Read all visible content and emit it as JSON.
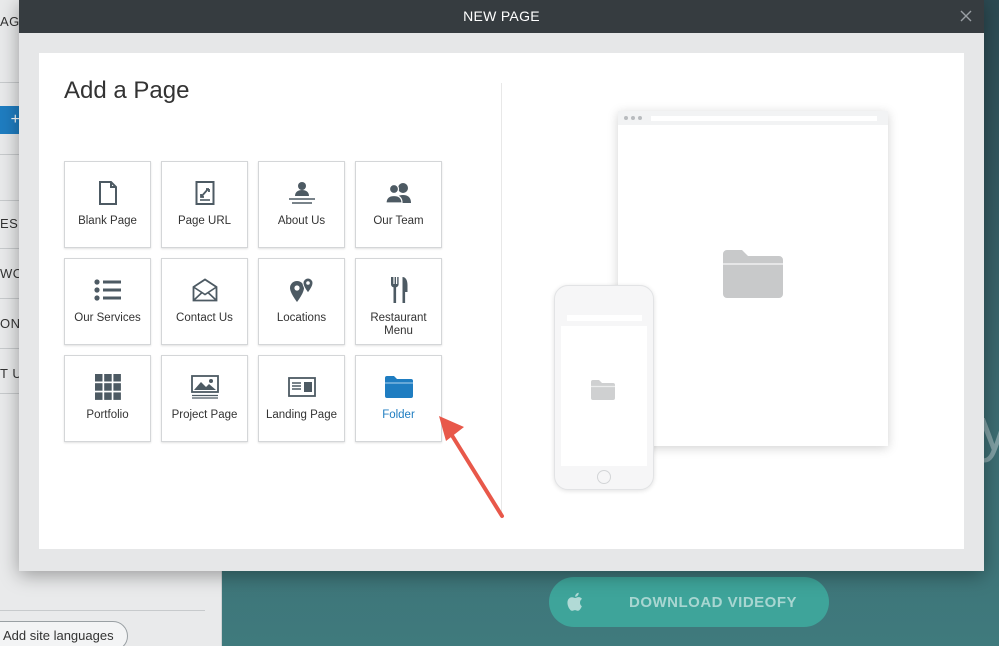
{
  "background": {
    "left_fragments": [
      "AGE",
      "ES",
      "WO",
      "ONI",
      "T U"
    ],
    "add_button_glyph": "+",
    "languages_button": "Add site languages",
    "hero_letter": "y",
    "download_button": "DOWNLOAD VIDEOFY"
  },
  "modal": {
    "title": "NEW PAGE",
    "close_glyph": "✕",
    "heading": "Add a Page",
    "tiles": [
      {
        "label": "Blank Page",
        "icon": "blank-page-icon"
      },
      {
        "label": "Page URL",
        "icon": "page-url-icon"
      },
      {
        "label": "About Us",
        "icon": "about-us-icon"
      },
      {
        "label": "Our Team",
        "icon": "our-team-icon"
      },
      {
        "label": "Our Services",
        "icon": "services-list-icon"
      },
      {
        "label": "Contact Us",
        "icon": "envelope-icon"
      },
      {
        "label": "Locations",
        "icon": "location-pin-icon"
      },
      {
        "label": "Restaurant Menu",
        "icon": "fork-knife-icon"
      },
      {
        "label": "Portfolio",
        "icon": "grid-icon"
      },
      {
        "label": "Project Page",
        "icon": "image-icon"
      },
      {
        "label": "Landing Page",
        "icon": "landing-page-icon"
      },
      {
        "label": "Folder",
        "icon": "folder-icon"
      }
    ],
    "selected_tile": "Folder"
  },
  "colors": {
    "accent": "#1f7dc1",
    "header": "#363c40",
    "icon": "#4d5a63",
    "arrow": "#e8584a"
  }
}
